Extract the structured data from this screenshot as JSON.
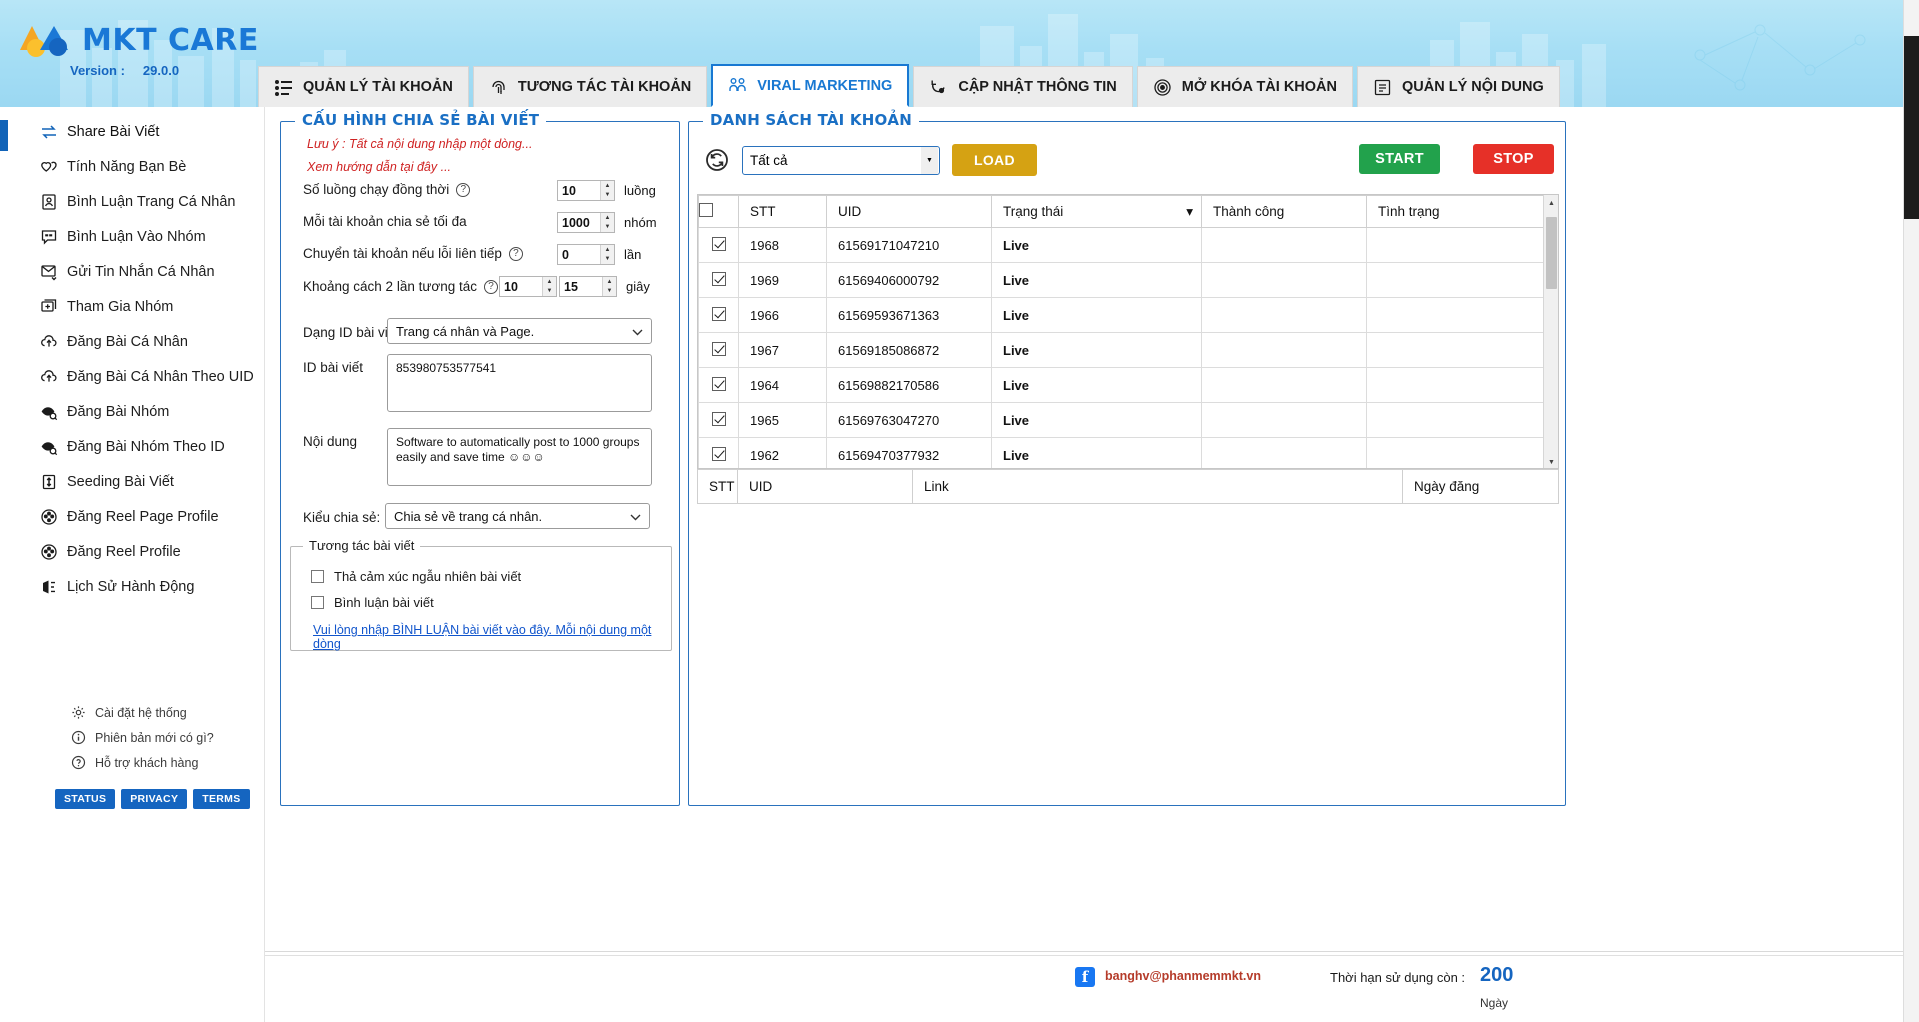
{
  "header": {
    "brand": "MKT CARE",
    "version_label": "Version :",
    "version_value": "29.0.0",
    "tabs": [
      {
        "label": "QUẢN LÝ TÀI KHOẢN",
        "icon": "list-settings-icon",
        "active": false
      },
      {
        "label": "TƯƠNG TÁC TÀI KHOẢN",
        "icon": "fingerprint-icon",
        "active": false
      },
      {
        "label": "VIRAL MARKETING",
        "icon": "people-icon",
        "active": true
      },
      {
        "label": "CẬP NHẬT THÔNG TIN",
        "icon": "refresh-user-icon",
        "active": false
      },
      {
        "label": "MỞ KHÓA TÀI KHOẢN",
        "icon": "fingerprint-round-icon",
        "active": false
      },
      {
        "label": "QUẢN LÝ NỘI DUNG",
        "icon": "document-icon",
        "active": false
      }
    ]
  },
  "sidebar": {
    "items": [
      {
        "label": "Share Bài Viết",
        "icon": "share-arrows-icon",
        "active": true
      },
      {
        "label": "Tính Năng Bạn Bè",
        "icon": "hearts-icon",
        "active": false
      },
      {
        "label": "Bình Luận Trang Cá Nhân",
        "icon": "profile-card-icon",
        "active": false
      },
      {
        "label": "Bình Luận Vào Nhóm",
        "icon": "comment-quote-icon",
        "active": false
      },
      {
        "label": "Gửi Tin Nhắn Cá Nhân",
        "icon": "mail-send-icon",
        "active": false
      },
      {
        "label": "Tham Gia Nhóm",
        "icon": "group-join-icon",
        "active": false
      },
      {
        "label": "Đăng Bài Cá Nhân",
        "icon": "cloud-upload-icon",
        "active": false
      },
      {
        "label": "Đăng Bài Cá Nhân Theo UID",
        "icon": "cloud-upload-icon",
        "active": false
      },
      {
        "label": "Đăng Bài Nhóm",
        "icon": "eye-search-icon",
        "active": false
      },
      {
        "label": "Đăng Bài Nhóm Theo ID",
        "icon": "eye-search-icon",
        "active": false
      },
      {
        "label": "Seeding Bài Viết",
        "icon": "updown-arrows-icon",
        "active": false
      },
      {
        "label": "Đăng Reel Page Profile",
        "icon": "film-reel-icon",
        "active": false
      },
      {
        "label": "Đăng Reel Profile",
        "icon": "film-reel-icon",
        "active": false
      },
      {
        "label": "Lịch Sử Hành Động",
        "icon": "history-icon",
        "active": false
      }
    ],
    "sub_items": [
      {
        "label": "Cài đặt hệ thống",
        "icon": "gear-icon"
      },
      {
        "label": "Phiên bản mới có gì?",
        "icon": "info-icon"
      },
      {
        "label": "Hỗ trợ khách hàng",
        "icon": "question-icon"
      }
    ],
    "pills": [
      "STATUS",
      "PRIVACY",
      "TERMS"
    ]
  },
  "config": {
    "title": "CẤU HÌNH CHIA SẺ BÀI VIẾT",
    "note1": "Lưu ý : Tất cả nội dung nhập một dòng...",
    "note2": "Xem hướng dẫn tại đây ...",
    "threads": {
      "label": "Số luồng chạy đồng thời",
      "value": "10",
      "unit": "luồng",
      "help": "?"
    },
    "max_share": {
      "label": "Mỗi tài khoản chia sẻ tối đa",
      "value": "1000",
      "unit": "nhóm"
    },
    "switch_err": {
      "label": "Chuyển tài khoản nếu lỗi liên tiếp",
      "value": "0",
      "unit": "lần",
      "help": "?"
    },
    "interval": {
      "label": "Khoảng cách 2 lần tương tác",
      "from": "10",
      "to": "15",
      "unit": "giây",
      "help": "?"
    },
    "post_type": {
      "label": "Dạng ID bài viết",
      "value": "Trang cá nhân và Page."
    },
    "post_id": {
      "label": "ID bài viết",
      "value": "853980753577541"
    },
    "content": {
      "label": "Nội dung",
      "value": "Software to automatically post to 1000 groups easily and save time ☺☺☺"
    },
    "share_type": {
      "label": "Kiểu chia sẻ:",
      "value": "Chia sẻ về trang cá nhân."
    },
    "interaction": {
      "title": "Tương tác bài viết",
      "cb1": "Thả cảm xúc ngẫu nhiên bài viết",
      "cb2": "Bình luận bài viết",
      "link": "Vui lòng nhập BÌNH LUẬN bài viết vào đây. Mỗi nội dung một dòng"
    }
  },
  "list": {
    "title": "DANH SÁCH TÀI KHOẢN",
    "filter_value": "Tất cả",
    "load_label": "LOAD",
    "start_label": "START",
    "stop_label": "STOP",
    "columns": [
      "STT",
      "UID",
      "Trạng thái",
      "Thành công",
      "Tình trạng"
    ],
    "rows": [
      {
        "stt": "1968",
        "uid": "61569171047210",
        "status": "Live",
        "success": "",
        "condition": "",
        "checked": true
      },
      {
        "stt": "1969",
        "uid": "61569406000792",
        "status": "Live",
        "success": "",
        "condition": "",
        "checked": true
      },
      {
        "stt": "1966",
        "uid": "61569593671363",
        "status": "Live",
        "success": "",
        "condition": "",
        "checked": true
      },
      {
        "stt": "1967",
        "uid": "61569185086872",
        "status": "Live",
        "success": "",
        "condition": "",
        "checked": true
      },
      {
        "stt": "1964",
        "uid": "61569882170586",
        "status": "Live",
        "success": "",
        "condition": "",
        "checked": true
      },
      {
        "stt": "1965",
        "uid": "61569763047270",
        "status": "Live",
        "success": "",
        "condition": "",
        "checked": true
      },
      {
        "stt": "1962",
        "uid": "61569470377932",
        "status": "Live",
        "success": "",
        "condition": "",
        "checked": true
      }
    ],
    "link_columns": [
      "STT",
      "UID",
      "Link",
      "Ngày đăng"
    ]
  },
  "footer": {
    "email": "banghv@phanmemmkt.vn",
    "expire_label": "Thời hạn sử dụng còn :",
    "expire_value": "200",
    "expire_unit": "Ngày"
  },
  "colors": {
    "brand_blue": "#1a78d6",
    "accent_blue": "#1878d2",
    "load_gold": "#d5a213",
    "start_green": "#22a24c",
    "stop_red": "#e63028",
    "live_green": "#0a9e2f"
  }
}
